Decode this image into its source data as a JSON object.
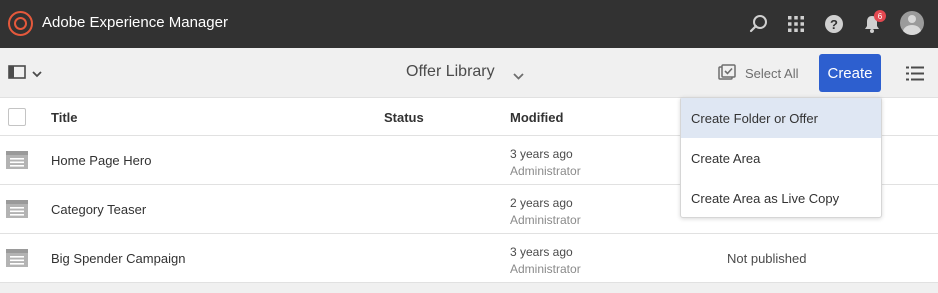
{
  "header": {
    "app_title": "Adobe Experience Manager",
    "notification_count": "6",
    "icons": [
      "search-icon",
      "apps-grid-icon",
      "help-icon",
      "bell-icon",
      "user-avatar"
    ]
  },
  "toolbar": {
    "page_title": "Offer Library",
    "select_all_label": "Select All",
    "create_label": "Create"
  },
  "table": {
    "columns": [
      "Title",
      "Status",
      "Modified"
    ],
    "rows": [
      {
        "title": "Home Page Hero",
        "modified": "3 years ago",
        "modified_by": "Administrator",
        "published": ""
      },
      {
        "title": "Category Teaser",
        "modified": "2 years ago",
        "modified_by": "Administrator",
        "published": ""
      },
      {
        "title": "Big Spender Campaign",
        "modified": "3 years ago",
        "modified_by": "Administrator",
        "published": "Not published"
      }
    ]
  },
  "create_menu": {
    "items": [
      "Create Folder or Offer",
      "Create Area",
      "Create Area as Live Copy"
    ],
    "active_index": 0
  },
  "colors": {
    "header_bg": "#323232",
    "accent": "#2d5fcf",
    "logo": "#e5593c",
    "badge": "#e34850",
    "menu_hover": "#dfe7f3"
  }
}
